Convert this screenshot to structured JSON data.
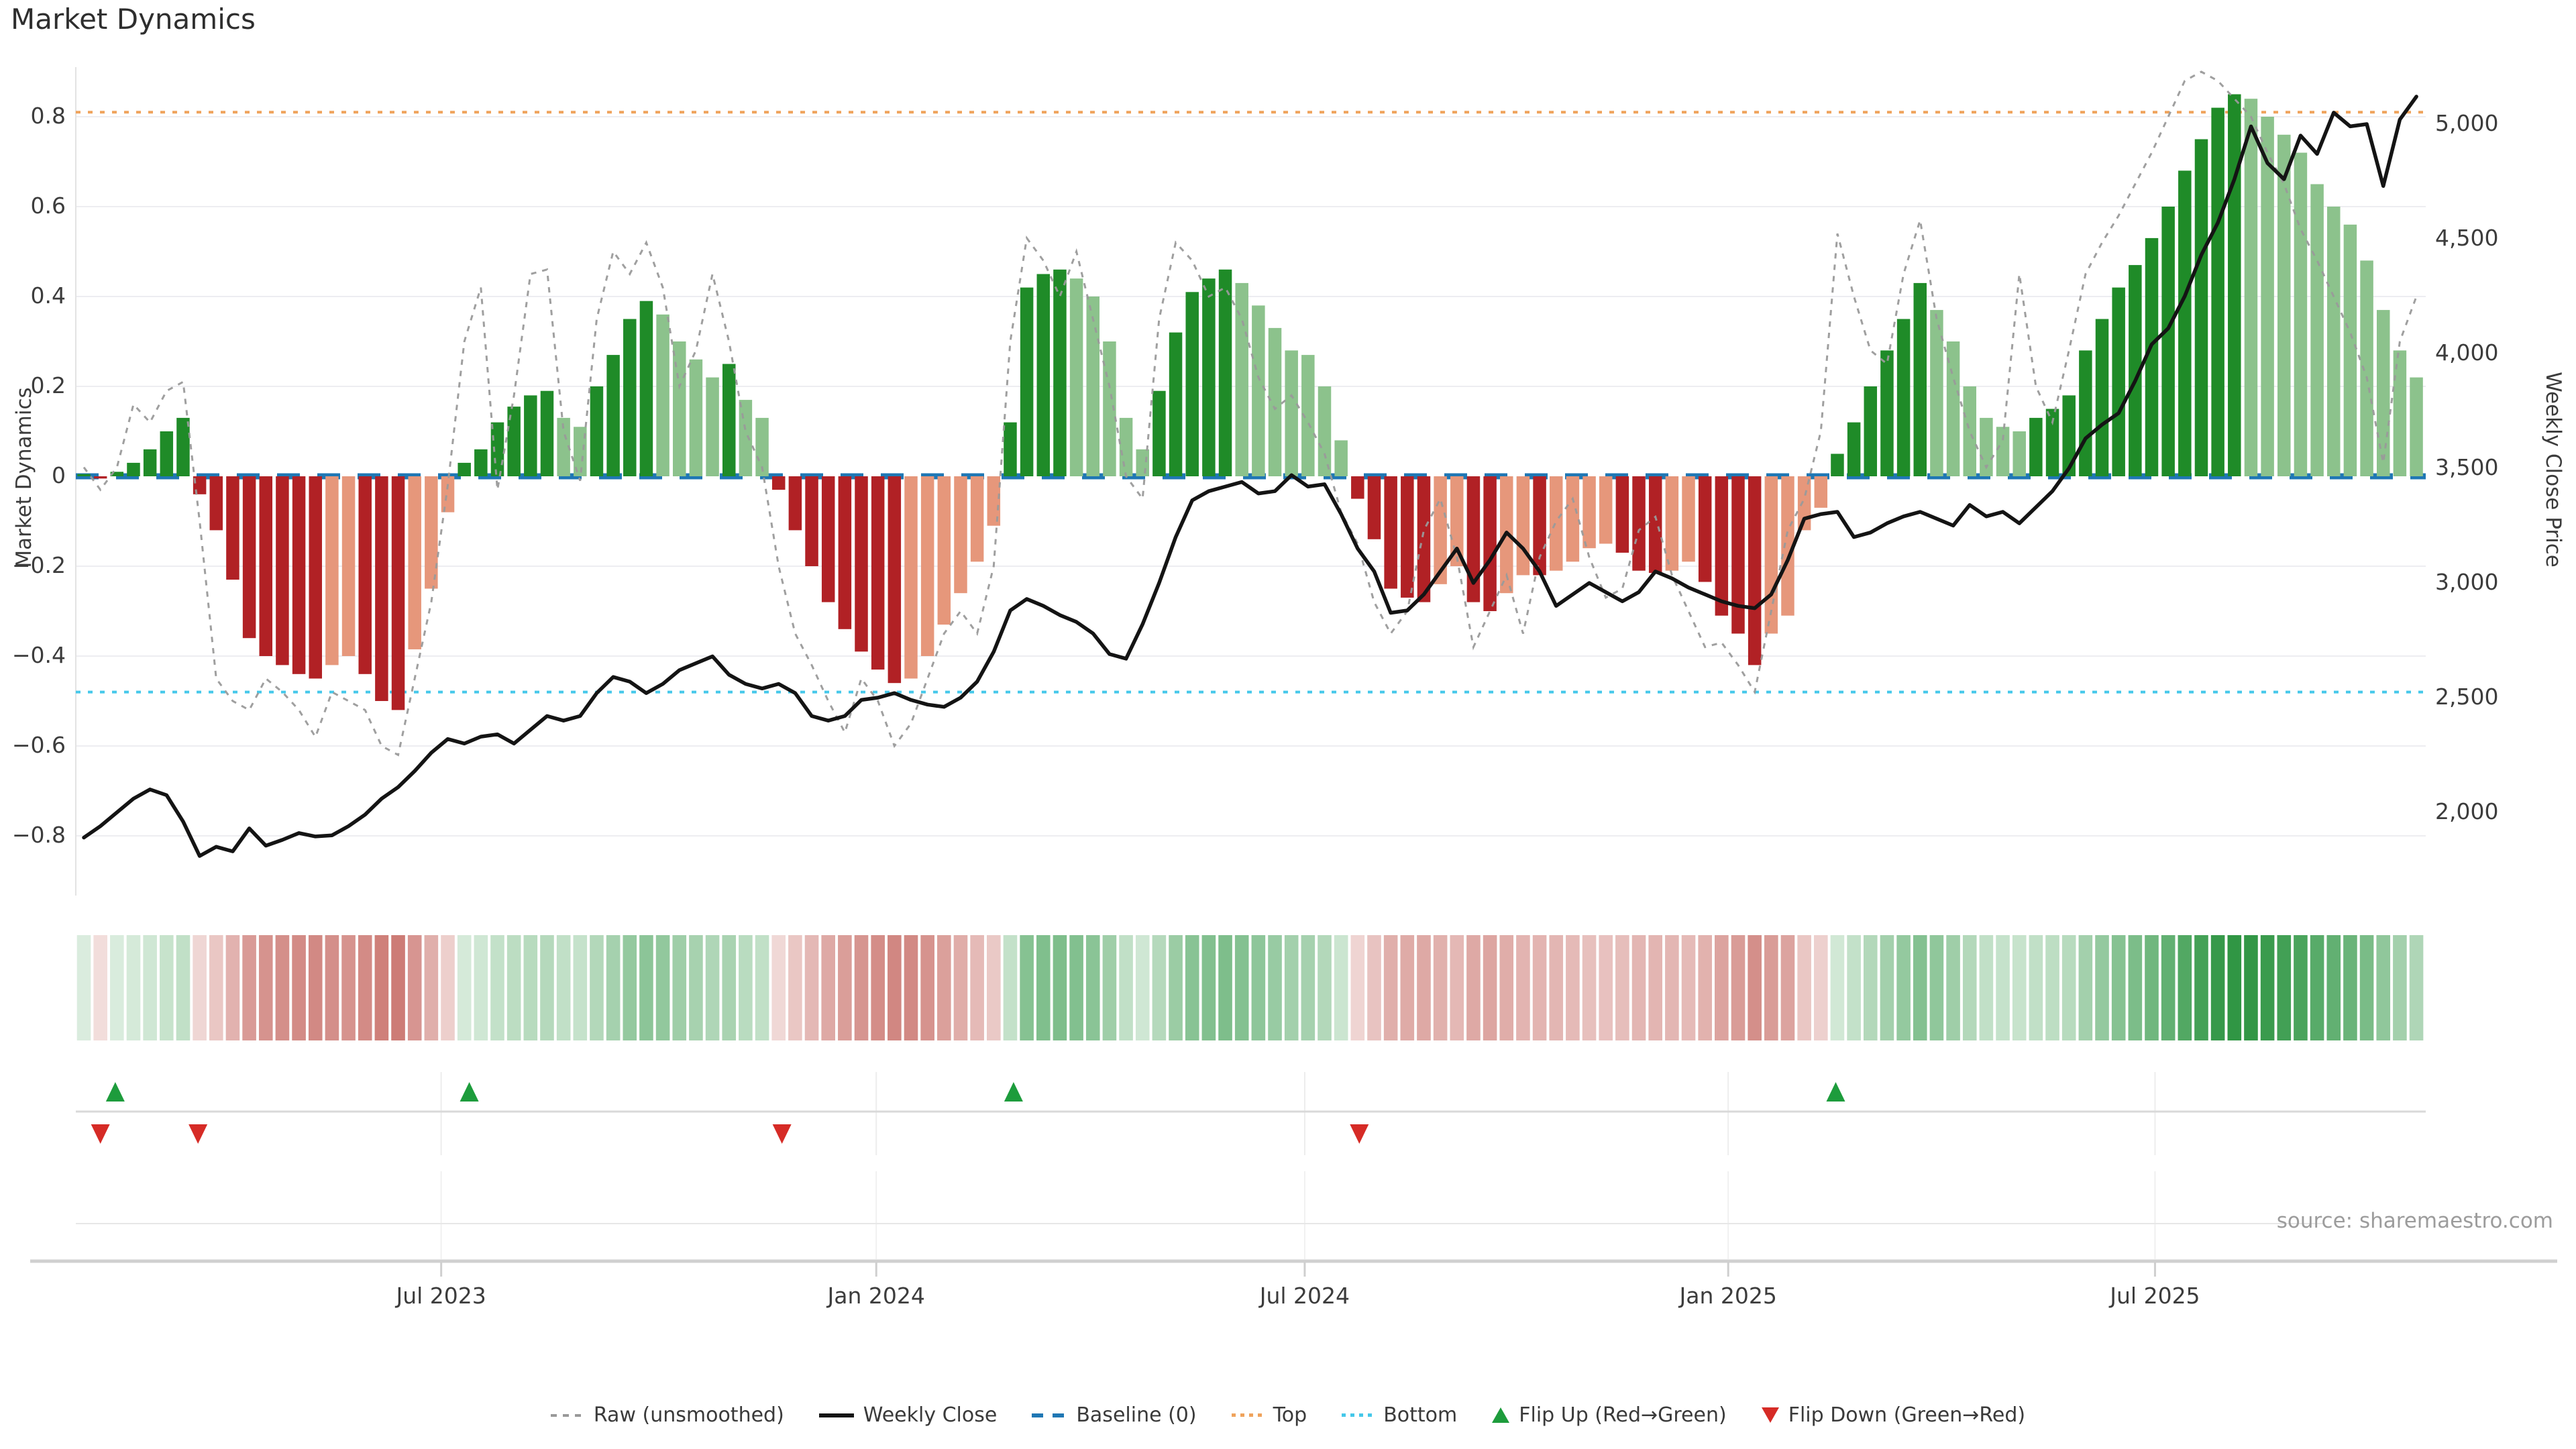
{
  "title": "Market Dynamics",
  "source": "source: sharemaestro.com",
  "axes": {
    "left_label": "Market Dynamics",
    "right_label": "Weekly Close Price",
    "left_ticks": [
      {
        "value": 0.8,
        "label": "0.8"
      },
      {
        "value": 0.6,
        "label": "0.6"
      },
      {
        "value": 0.4,
        "label": "0.4"
      },
      {
        "value": 0.2,
        "label": "0.2"
      },
      {
        "value": 0.0,
        "label": "0"
      },
      {
        "value": -0.2,
        "label": "−0.2"
      },
      {
        "value": -0.4,
        "label": "−0.4"
      },
      {
        "value": -0.6,
        "label": "−0.6"
      },
      {
        "value": -0.8,
        "label": "−0.8"
      }
    ],
    "right_ticks": [
      {
        "value": 5000,
        "label": "5,000"
      },
      {
        "value": 4500,
        "label": "4,500"
      },
      {
        "value": 4000,
        "label": "4,000"
      },
      {
        "value": 3500,
        "label": "3,500"
      },
      {
        "value": 3000,
        "label": "3,000"
      },
      {
        "value": 2500,
        "label": "2,500"
      },
      {
        "value": 2000,
        "label": "2,000"
      }
    ],
    "x_ticks": [
      {
        "label": "Jul 2023",
        "week": 21.6
      },
      {
        "label": "Jan 2024",
        "week": 47.9
      },
      {
        "label": "Jul 2024",
        "week": 73.8
      },
      {
        "label": "Jan 2025",
        "week": 99.4
      },
      {
        "label": "Jul 2025",
        "week": 125.2
      }
    ]
  },
  "legend": [
    {
      "label": "Raw (unsmoothed)",
      "swatch": "raw"
    },
    {
      "label": "Weekly Close",
      "swatch": "close"
    },
    {
      "label": "Baseline (0)",
      "swatch": "baseline"
    },
    {
      "label": "Top",
      "swatch": "top"
    },
    {
      "label": "Bottom",
      "swatch": "bottom"
    },
    {
      "label": "Flip Up (Red→Green)",
      "swatch": "flip-up"
    },
    {
      "label": "Flip Down (Green→Red)",
      "swatch": "flip-down"
    }
  ],
  "colors": {
    "bar_green_dark": "#1F8B28",
    "bar_green_light": "#8CC28C",
    "bar_red_dark": "#B12125",
    "bar_red_light": "#E6977B",
    "baseline_blue": "#1F77B4",
    "top_orange": "#EFA35C",
    "bottom_cyan": "#45C8EA",
    "raw_gray": "#9A9A9A",
    "price_black": "#141414",
    "grid": "#EDEDF1",
    "panel_line": "#D9D9D9",
    "heat_green": "#2B9440",
    "heat_red": "#B43A31",
    "marker_green": "#1D9C3C",
    "marker_red": "#D62B26"
  },
  "chart_data": {
    "type": "bar",
    "subtype": "combo-bar-line",
    "title": "Market Dynamics",
    "ylabel_left": "Market Dynamics",
    "ylabel_right": "Weekly Close Price",
    "left_range": [
      -0.9,
      0.92
    ],
    "right_range": [
      1800,
      5200
    ],
    "grid": true,
    "legend_position": "bottom-center",
    "reference_lines": {
      "baseline": 0,
      "top": 0.81,
      "bottom": -0.48
    },
    "flip_up_weeks": [
      1.9,
      23.3,
      56.2,
      105.9
    ],
    "flip_down_weeks": [
      1.0,
      6.9,
      42.2,
      77.1
    ],
    "n_weeks": 142,
    "series": [
      {
        "name": "Market Dynamics (smoothed)",
        "type": "bar",
        "axis": "left",
        "values": [
          0.005,
          -0.005,
          0.01,
          0.03,
          0.06,
          0.1,
          0.13,
          -0.04,
          -0.12,
          -0.23,
          -0.36,
          -0.4,
          -0.42,
          -0.44,
          -0.45,
          -0.42,
          -0.4,
          -0.44,
          -0.5,
          -0.52,
          -0.385,
          -0.25,
          -0.08,
          0.03,
          0.06,
          0.12,
          0.155,
          0.18,
          0.19,
          0.13,
          0.11,
          0.2,
          0.27,
          0.35,
          0.39,
          0.36,
          0.3,
          0.26,
          0.22,
          0.25,
          0.17,
          0.13,
          -0.03,
          -0.12,
          -0.2,
          -0.28,
          -0.34,
          -0.39,
          -0.43,
          -0.46,
          -0.45,
          -0.4,
          -0.33,
          -0.26,
          -0.19,
          -0.11,
          0.12,
          0.42,
          0.45,
          0.46,
          0.44,
          0.4,
          0.3,
          0.13,
          0.06,
          0.19,
          0.32,
          0.41,
          0.44,
          0.46,
          0.43,
          0.38,
          0.33,
          0.28,
          0.27,
          0.2,
          0.08,
          -0.05,
          -0.14,
          -0.25,
          -0.27,
          -0.28,
          -0.24,
          -0.2,
          -0.28,
          -0.3,
          -0.26,
          -0.22,
          -0.22,
          -0.21,
          -0.19,
          -0.16,
          -0.15,
          -0.17,
          -0.21,
          -0.215,
          -0.21,
          -0.19,
          -0.235,
          -0.31,
          -0.35,
          -0.42,
          -0.35,
          -0.31,
          -0.12,
          -0.07,
          0.05,
          0.12,
          0.2,
          0.28,
          0.35,
          0.43,
          0.37,
          0.3,
          0.2,
          0.13,
          0.11,
          0.1,
          0.13,
          0.15,
          0.18,
          0.28,
          0.35,
          0.42,
          0.47,
          0.53,
          0.6,
          0.68,
          0.75,
          0.82,
          0.85,
          0.84,
          0.8,
          0.76,
          0.72,
          0.65,
          0.6,
          0.56,
          0.48,
          0.37,
          0.28,
          0.22
        ]
      },
      {
        "name": "Raw (unsmoothed)",
        "type": "line",
        "style": "dotted",
        "axis": "left",
        "values": [
          0.02,
          -0.03,
          0.02,
          0.16,
          0.12,
          0.19,
          0.21,
          -0.1,
          -0.45,
          -0.5,
          -0.52,
          -0.45,
          -0.48,
          -0.52,
          -0.58,
          -0.48,
          -0.5,
          -0.52,
          -0.6,
          -0.62,
          -0.45,
          -0.28,
          -0.02,
          0.3,
          0.42,
          -0.03,
          0.18,
          0.45,
          0.46,
          0.1,
          -0.01,
          0.35,
          0.5,
          0.45,
          0.52,
          0.42,
          0.2,
          0.28,
          0.45,
          0.3,
          0.1,
          0.02,
          -0.2,
          -0.35,
          -0.42,
          -0.5,
          -0.57,
          -0.45,
          -0.5,
          -0.6,
          -0.55,
          -0.45,
          -0.35,
          -0.3,
          -0.35,
          -0.2,
          0.3,
          0.53,
          0.48,
          0.4,
          0.5,
          0.35,
          0.2,
          0.0,
          -0.05,
          0.35,
          0.52,
          0.48,
          0.4,
          0.42,
          0.35,
          0.22,
          0.15,
          0.18,
          0.12,
          0.05,
          -0.08,
          -0.15,
          -0.28,
          -0.35,
          -0.3,
          -0.12,
          -0.05,
          -0.18,
          -0.38,
          -0.3,
          -0.22,
          -0.35,
          -0.18,
          -0.1,
          -0.05,
          -0.18,
          -0.27,
          -0.25,
          -0.12,
          -0.09,
          -0.22,
          -0.3,
          -0.38,
          -0.37,
          -0.42,
          -0.48,
          -0.3,
          -0.12,
          -0.05,
          0.1,
          0.54,
          0.4,
          0.28,
          0.25,
          0.45,
          0.57,
          0.35,
          0.22,
          0.1,
          0.02,
          0.08,
          0.45,
          0.2,
          0.12,
          0.28,
          0.45,
          0.52,
          0.58,
          0.65,
          0.72,
          0.8,
          0.88,
          0.9,
          0.88,
          0.84,
          0.8,
          0.72,
          0.65,
          0.55,
          0.48,
          0.4,
          0.32,
          0.22,
          0.03,
          0.3,
          0.4
        ]
      },
      {
        "name": "Weekly Close",
        "type": "line",
        "style": "solid",
        "axis": "right",
        "values": [
          1890,
          1940,
          2000,
          2060,
          2100,
          2075,
          1960,
          1810,
          1850,
          1830,
          1930,
          1855,
          1880,
          1910,
          1895,
          1900,
          1940,
          1990,
          2060,
          2110,
          2180,
          2260,
          2320,
          2300,
          2330,
          2340,
          2300,
          2360,
          2420,
          2400,
          2420,
          2520,
          2590,
          2570,
          2520,
          2560,
          2620,
          2650,
          2680,
          2600,
          2560,
          2540,
          2560,
          2520,
          2420,
          2400,
          2420,
          2490,
          2500,
          2520,
          2490,
          2470,
          2460,
          2500,
          2570,
          2700,
          2880,
          2930,
          2900,
          2860,
          2830,
          2780,
          2690,
          2670,
          2820,
          3000,
          3200,
          3360,
          3400,
          3420,
          3440,
          3390,
          3400,
          3470,
          3420,
          3430,
          3300,
          3150,
          3050,
          2870,
          2880,
          2950,
          3050,
          3150,
          3000,
          3100,
          3220,
          3150,
          3050,
          2900,
          2950,
          3000,
          2960,
          2920,
          2960,
          3050,
          3020,
          2980,
          2950,
          2920,
          2900,
          2890,
          2950,
          3100,
          3280,
          3300,
          3310,
          3200,
          3220,
          3260,
          3290,
          3310,
          3280,
          3250,
          3340,
          3290,
          3310,
          3260,
          3330,
          3400,
          3500,
          3630,
          3690,
          3740,
          3880,
          4040,
          4110,
          4250,
          4430,
          4570,
          4760,
          4990,
          4830,
          4760,
          4950,
          4870,
          5050,
          4990,
          5000,
          4730,
          5020,
          5120
        ]
      }
    ],
    "heatmap": {
      "note": "strip encodes sign and magnitude of smoothed market dynamics per week"
    }
  }
}
